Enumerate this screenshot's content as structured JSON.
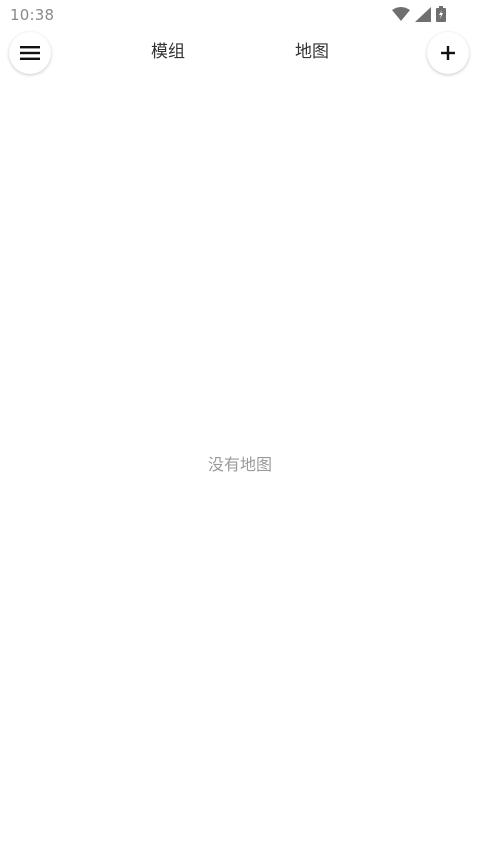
{
  "status_bar": {
    "time": "10:38",
    "icons": [
      "wifi-icon",
      "cellular-signal-icon",
      "battery-charging-icon"
    ]
  },
  "top_bar": {
    "menu_icon": "hamburger-menu-icon",
    "tabs": [
      {
        "label": "模组"
      },
      {
        "label": "地图"
      }
    ],
    "add_icon": "plus-icon"
  },
  "content": {
    "empty_message": "没有地图"
  },
  "colors": {
    "background": "#ffffff",
    "status_text": "#8a8a8a",
    "tab_text": "#333333",
    "empty_text": "#9a9a9a",
    "icon": "#111111"
  }
}
